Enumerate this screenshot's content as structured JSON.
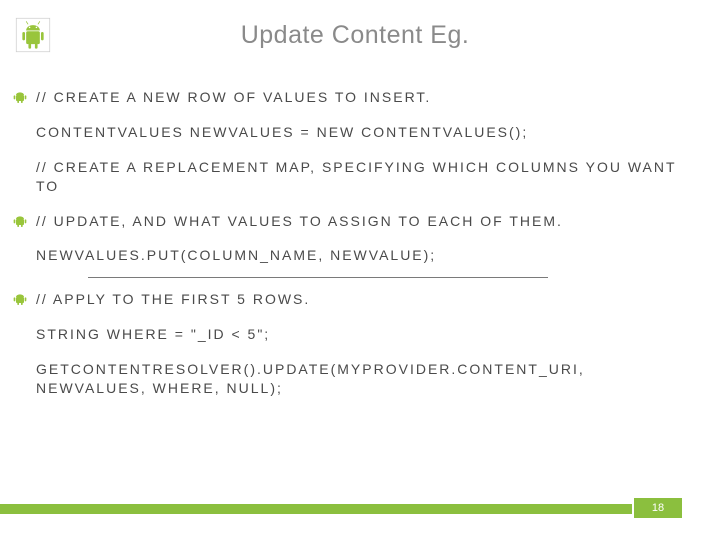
{
  "title": "Update Content Eg.",
  "lines": {
    "l1": "// CREATE A NEW ROW OF VALUES TO INSERT.",
    "l2": "CONTENTVALUES NEWVALUES = NEW CONTENTVALUES();",
    "l3": "// CREATE A REPLACEMENT MAP, SPECIFYING WHICH COLUMNS YOU WANT TO",
    "l4": "// UPDATE, AND WHAT VALUES TO ASSIGN TO EACH OF THEM.",
    "l5": "NEWVALUES.PUT(COLUMN_NAME, NEWVALUE);",
    "l6": "// APPLY TO THE FIRST 5 ROWS.",
    "l7": "STRING WHERE = \"_ID < 5\";",
    "l8": "GETCONTENTRESOLVER().UPDATE(MYPROVIDER.CONTENT_URI, NEWVALUES, WHERE, NULL);"
  },
  "page_number": "18",
  "colors": {
    "accent": "#8bbf3e",
    "title_grey": "#8a8a8a",
    "text": "#4a4a4a"
  }
}
